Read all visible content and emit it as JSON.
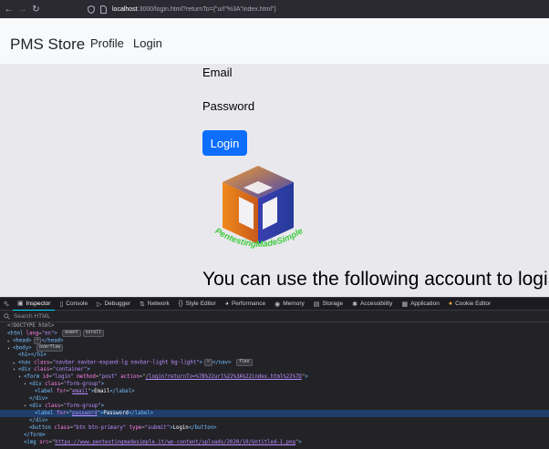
{
  "browser": {
    "url_host": "localhost",
    "url_rest": ":3000/login.html?returnTo={\"url\"%3A\"index.html\"}"
  },
  "page": {
    "brand": "PMS Store",
    "nav": [
      "Profile",
      "Login"
    ],
    "email_label": "Email",
    "password_label": "Password",
    "login_button": "Login",
    "logo_text": "PentestingMadeSimple",
    "info_text": "You can use the following account to logi"
  },
  "devtools": {
    "tabs": [
      "Inspector",
      "Console",
      "Debugger",
      "Network",
      "Style Editor",
      "Performance",
      "Memory",
      "Storage",
      "Accessibility",
      "Application",
      "Cookie Editor"
    ],
    "search_placeholder": "Search HTML",
    "badges": {
      "event": "event",
      "scroll": "scroll",
      "overflow": "overflow",
      "flex": "flex",
      "ellipsis": "⋯"
    },
    "html": {
      "doctype": "<!DOCTYPE html>",
      "html_lang_val": "\"en\"",
      "body": "body",
      "h1": "h1",
      "nav_class_val": "\"navbar navbar-expand-lg navbar-light bg-light\"",
      "container_class_val": "\"container\"",
      "form_id_val": "\"login\"",
      "form_method_val": "\"post\"",
      "form_action_val": "/login?returnTo=%7B%22url%22%3A%22index.html%22%7D",
      "form_group_val": "\"form-group\"",
      "email_for_val": "email",
      "email_text": "Email",
      "password_for_val": "password",
      "password_text": "Password",
      "button_class_val": "\"btn btn-primary\"",
      "button_type_val": "\"submit\"",
      "button_text": "Login",
      "img_src_val": "https://www.pentestingmadesimple.it/wp-content/uploads/2020/10/Untitled-1.png"
    }
  },
  "colors": {
    "primary": "#0d6efd",
    "page_bg": "#e9e9ed",
    "navbar_bg": "#f8f9fa",
    "devtools_bg": "#232327",
    "selected_row": "#1f3e6b",
    "logo_orange": "#e8731c",
    "logo_blue": "#2a3f9e",
    "logo_text": "#3fcb3f"
  }
}
